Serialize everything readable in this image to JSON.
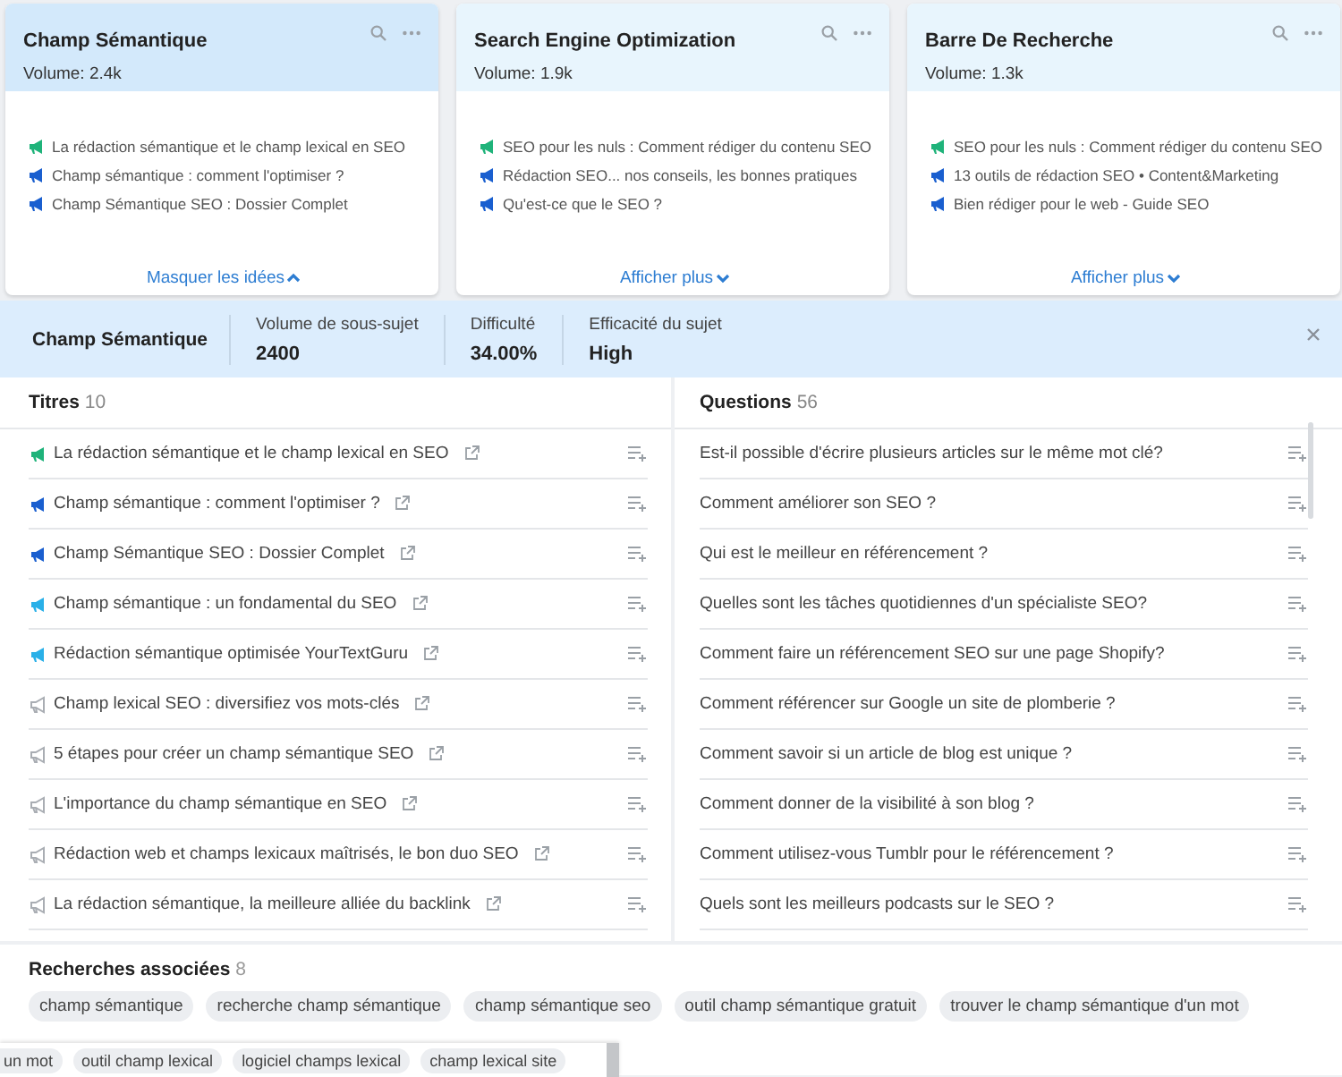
{
  "cards": [
    {
      "title": "Champ Sémantique",
      "volume": "Volume: 2.4k",
      "selected": true,
      "expanded": true,
      "toggle": "Masquer les idées",
      "ideas": [
        {
          "text": "La rédaction sémantique et le champ lexical en SEO",
          "color": "#1fb37a"
        },
        {
          "text": "Champ sémantique : comment l'optimiser ?",
          "color": "#1a5fcf"
        },
        {
          "text": "Champ Sémantique SEO : Dossier Complet",
          "color": "#1a5fcf"
        }
      ]
    },
    {
      "title": "Search Engine Optimization",
      "volume": "Volume: 1.9k",
      "selected": false,
      "expanded": false,
      "toggle": "Afficher plus",
      "ideas": [
        {
          "text": "SEO pour les nuls : Comment rédiger du contenu SEO",
          "color": "#1fb37a"
        },
        {
          "text": "Rédaction SEO... nos conseils, les bonnes pratiques",
          "color": "#1a5fcf"
        },
        {
          "text": "Qu'est-ce que le SEO ?",
          "color": "#1a5fcf"
        }
      ]
    },
    {
      "title": "Barre De Recherche",
      "volume": "Volume: 1.3k",
      "selected": false,
      "expanded": false,
      "toggle": "Afficher plus",
      "ideas": [
        {
          "text": "SEO pour les nuls : Comment rédiger du contenu SEO",
          "color": "#1fb37a"
        },
        {
          "text": "13 outils de rédaction SEO • Content&Marketing",
          "color": "#1a5fcf"
        },
        {
          "text": "Bien rédiger pour le web - Guide SEO",
          "color": "#1a5fcf"
        }
      ]
    }
  ],
  "detail": {
    "title": "Champ Sémantique",
    "metrics": [
      {
        "label": "Volume de sous-sujet",
        "value": "2400"
      },
      {
        "label": "Difficulté",
        "value": "34.00%"
      },
      {
        "label": "Efficacité du sujet",
        "value": "High"
      }
    ]
  },
  "titles": {
    "heading": "Titres",
    "count": "10",
    "items": [
      {
        "text": "La rédaction sémantique et le champ lexical en SEO",
        "color": "#1fb37a",
        "kind": "filled"
      },
      {
        "text": "Champ sémantique : comment l'optimiser ?",
        "color": "#1a5fcf",
        "kind": "filled"
      },
      {
        "text": "Champ Sémantique SEO : Dossier Complet",
        "color": "#1a5fcf",
        "kind": "filled"
      },
      {
        "text": "Champ sémantique : un fondamental du SEO",
        "color": "#2ab0e8",
        "kind": "filled"
      },
      {
        "text": "Rédaction sémantique optimisée YourTextGuru",
        "color": "#2ab0e8",
        "kind": "filled"
      },
      {
        "text": "Champ lexical SEO : diversifiez vos mots-clés",
        "color": "#a9adb3",
        "kind": "outline"
      },
      {
        "text": "5 étapes pour créer un champ sémantique SEO",
        "color": "#a9adb3",
        "kind": "outline"
      },
      {
        "text": "L'importance du champ sémantique en SEO",
        "color": "#a9adb3",
        "kind": "outline"
      },
      {
        "text": "Rédaction web et champs lexicaux maîtrisés, le bon duo SEO",
        "color": "#a9adb3",
        "kind": "outline"
      },
      {
        "text": "La rédaction sémantique, la meilleure alliée du backlink",
        "color": "#a9adb3",
        "kind": "outline"
      }
    ]
  },
  "questions": {
    "heading": "Questions",
    "count": "56",
    "items": [
      "Est-il possible d'écrire plusieurs articles sur le même mot clé?",
      "Comment améliorer son SEO ?",
      "Qui est le meilleur en référencement ?",
      "Quelles sont les tâches quotidiennes d'un spécialiste SEO?",
      "Comment faire un référencement SEO sur une page Shopify?",
      "Comment référencer sur Google un site de plomberie ?",
      "Comment savoir si un article de blog est unique ?",
      "Comment donner de la visibilité à son blog ?",
      "Comment utilisez-vous Tumblr pour le référencement ?",
      "Quels sont les meilleurs podcasts sur le SEO ?"
    ]
  },
  "related": {
    "heading": "Recherches associées",
    "count": "8",
    "tags": [
      "champ sémantique",
      "recherche champ sémantique",
      "champ sémantique seo",
      "outil champ sémantique gratuit",
      "trouver le champ sémantique d'un mot"
    ]
  },
  "overlay": {
    "tags": [
      "un mot",
      "outil champ lexical",
      "logiciel champs lexical",
      "champ lexical site"
    ]
  }
}
